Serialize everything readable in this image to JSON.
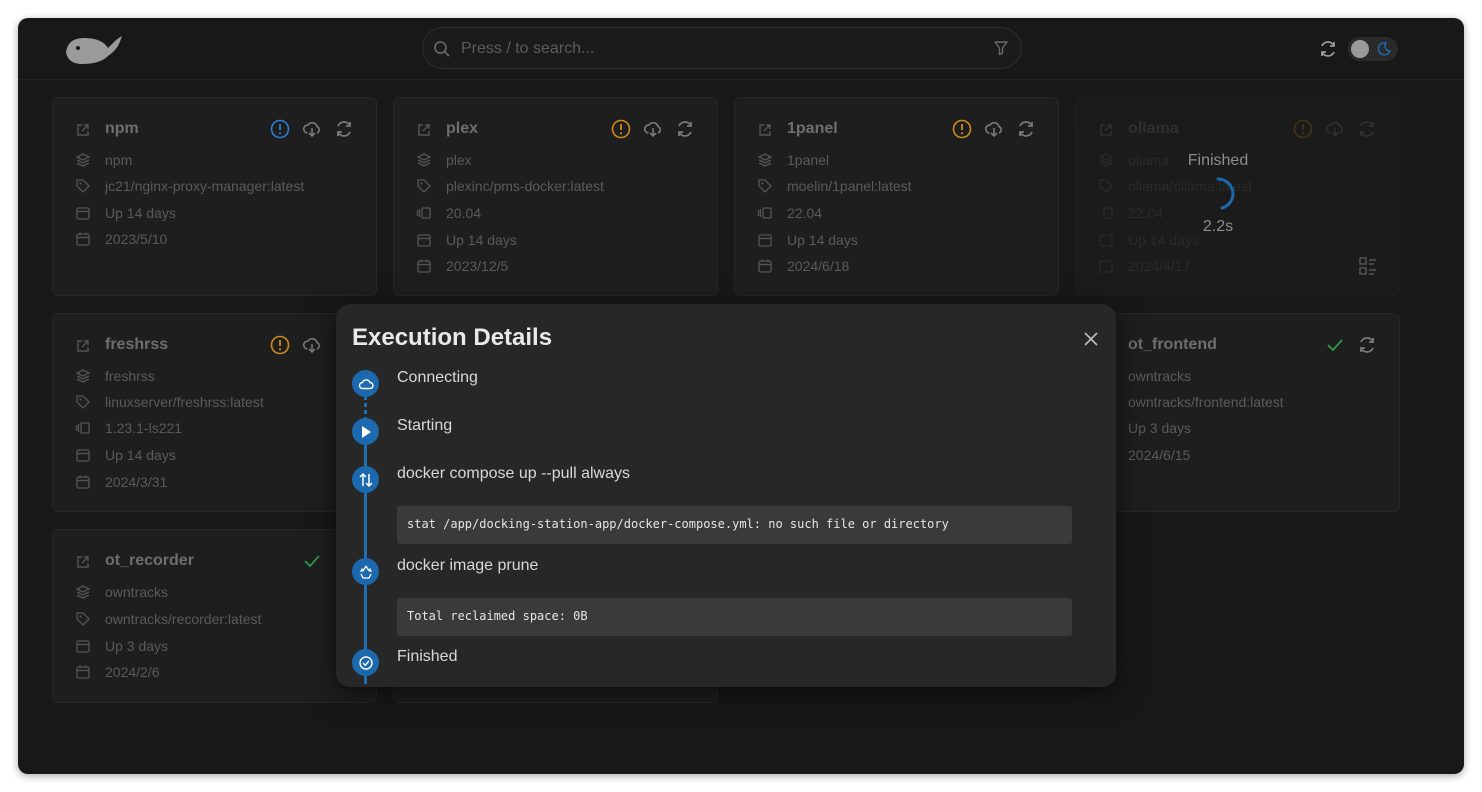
{
  "search": {
    "placeholder": "Press / to search..."
  },
  "cards": [
    {
      "name": "npm",
      "project": "npm",
      "image": "jc21/nginx-proxy-manager:latest",
      "status": "Up 14 days",
      "created": "2023/5/10"
    },
    {
      "name": "plex",
      "project": "plex",
      "image": "plexinc/pms-docker:latest",
      "version": "20.04",
      "status": "Up 14 days",
      "created": "2023/12/5"
    },
    {
      "name": "1panel",
      "project": "1panel",
      "image": "moelin/1panel:latest",
      "version": "22.04",
      "status": "Up 14 days",
      "created": "2024/6/18"
    },
    {
      "name": "ollama",
      "project": "ollama",
      "image": "ollama/ollama:latest",
      "version": "22.04",
      "status": "Up 14 days",
      "created": "2024/4/17"
    },
    {
      "name": "freshrss",
      "project": "freshrss",
      "image": "linuxserver/freshrss:latest",
      "version": "1.23.1-ls221",
      "status": "Up 14 days",
      "created": "2024/3/31"
    },
    {
      "name": "ot_frontend",
      "project": "owntracks",
      "image": "owntracks/frontend:latest",
      "status": "Up 3 days",
      "created": "2024/6/15"
    },
    {
      "name": "ot_recorder",
      "project": "owntracks",
      "image": "owntracks/recorder:latest",
      "status": "Up 3 days",
      "created": "2024/2/6"
    }
  ],
  "progress_overlay": {
    "label": "Finished",
    "time": "2.2s"
  },
  "modal": {
    "title": "Execution Details",
    "steps": [
      {
        "label": "Connecting",
        "icon": "cloud-icon"
      },
      {
        "label": "Starting",
        "icon": "play-icon"
      },
      {
        "label": "docker compose up --pull always",
        "icon": "transfer-icon",
        "log": "stat /app/docking-station-app/docker-compose.yml: no such file or directory"
      },
      {
        "label": "docker image prune",
        "icon": "recycle-icon",
        "log": "Total reclaimed space: 0B"
      },
      {
        "label": "Finished",
        "icon": "check-circle-icon"
      }
    ]
  },
  "colors": {
    "accent": "#1d69ad",
    "warning": "#d08a1c",
    "info": "#2a7fd0",
    "success": "#2e9a4a"
  }
}
